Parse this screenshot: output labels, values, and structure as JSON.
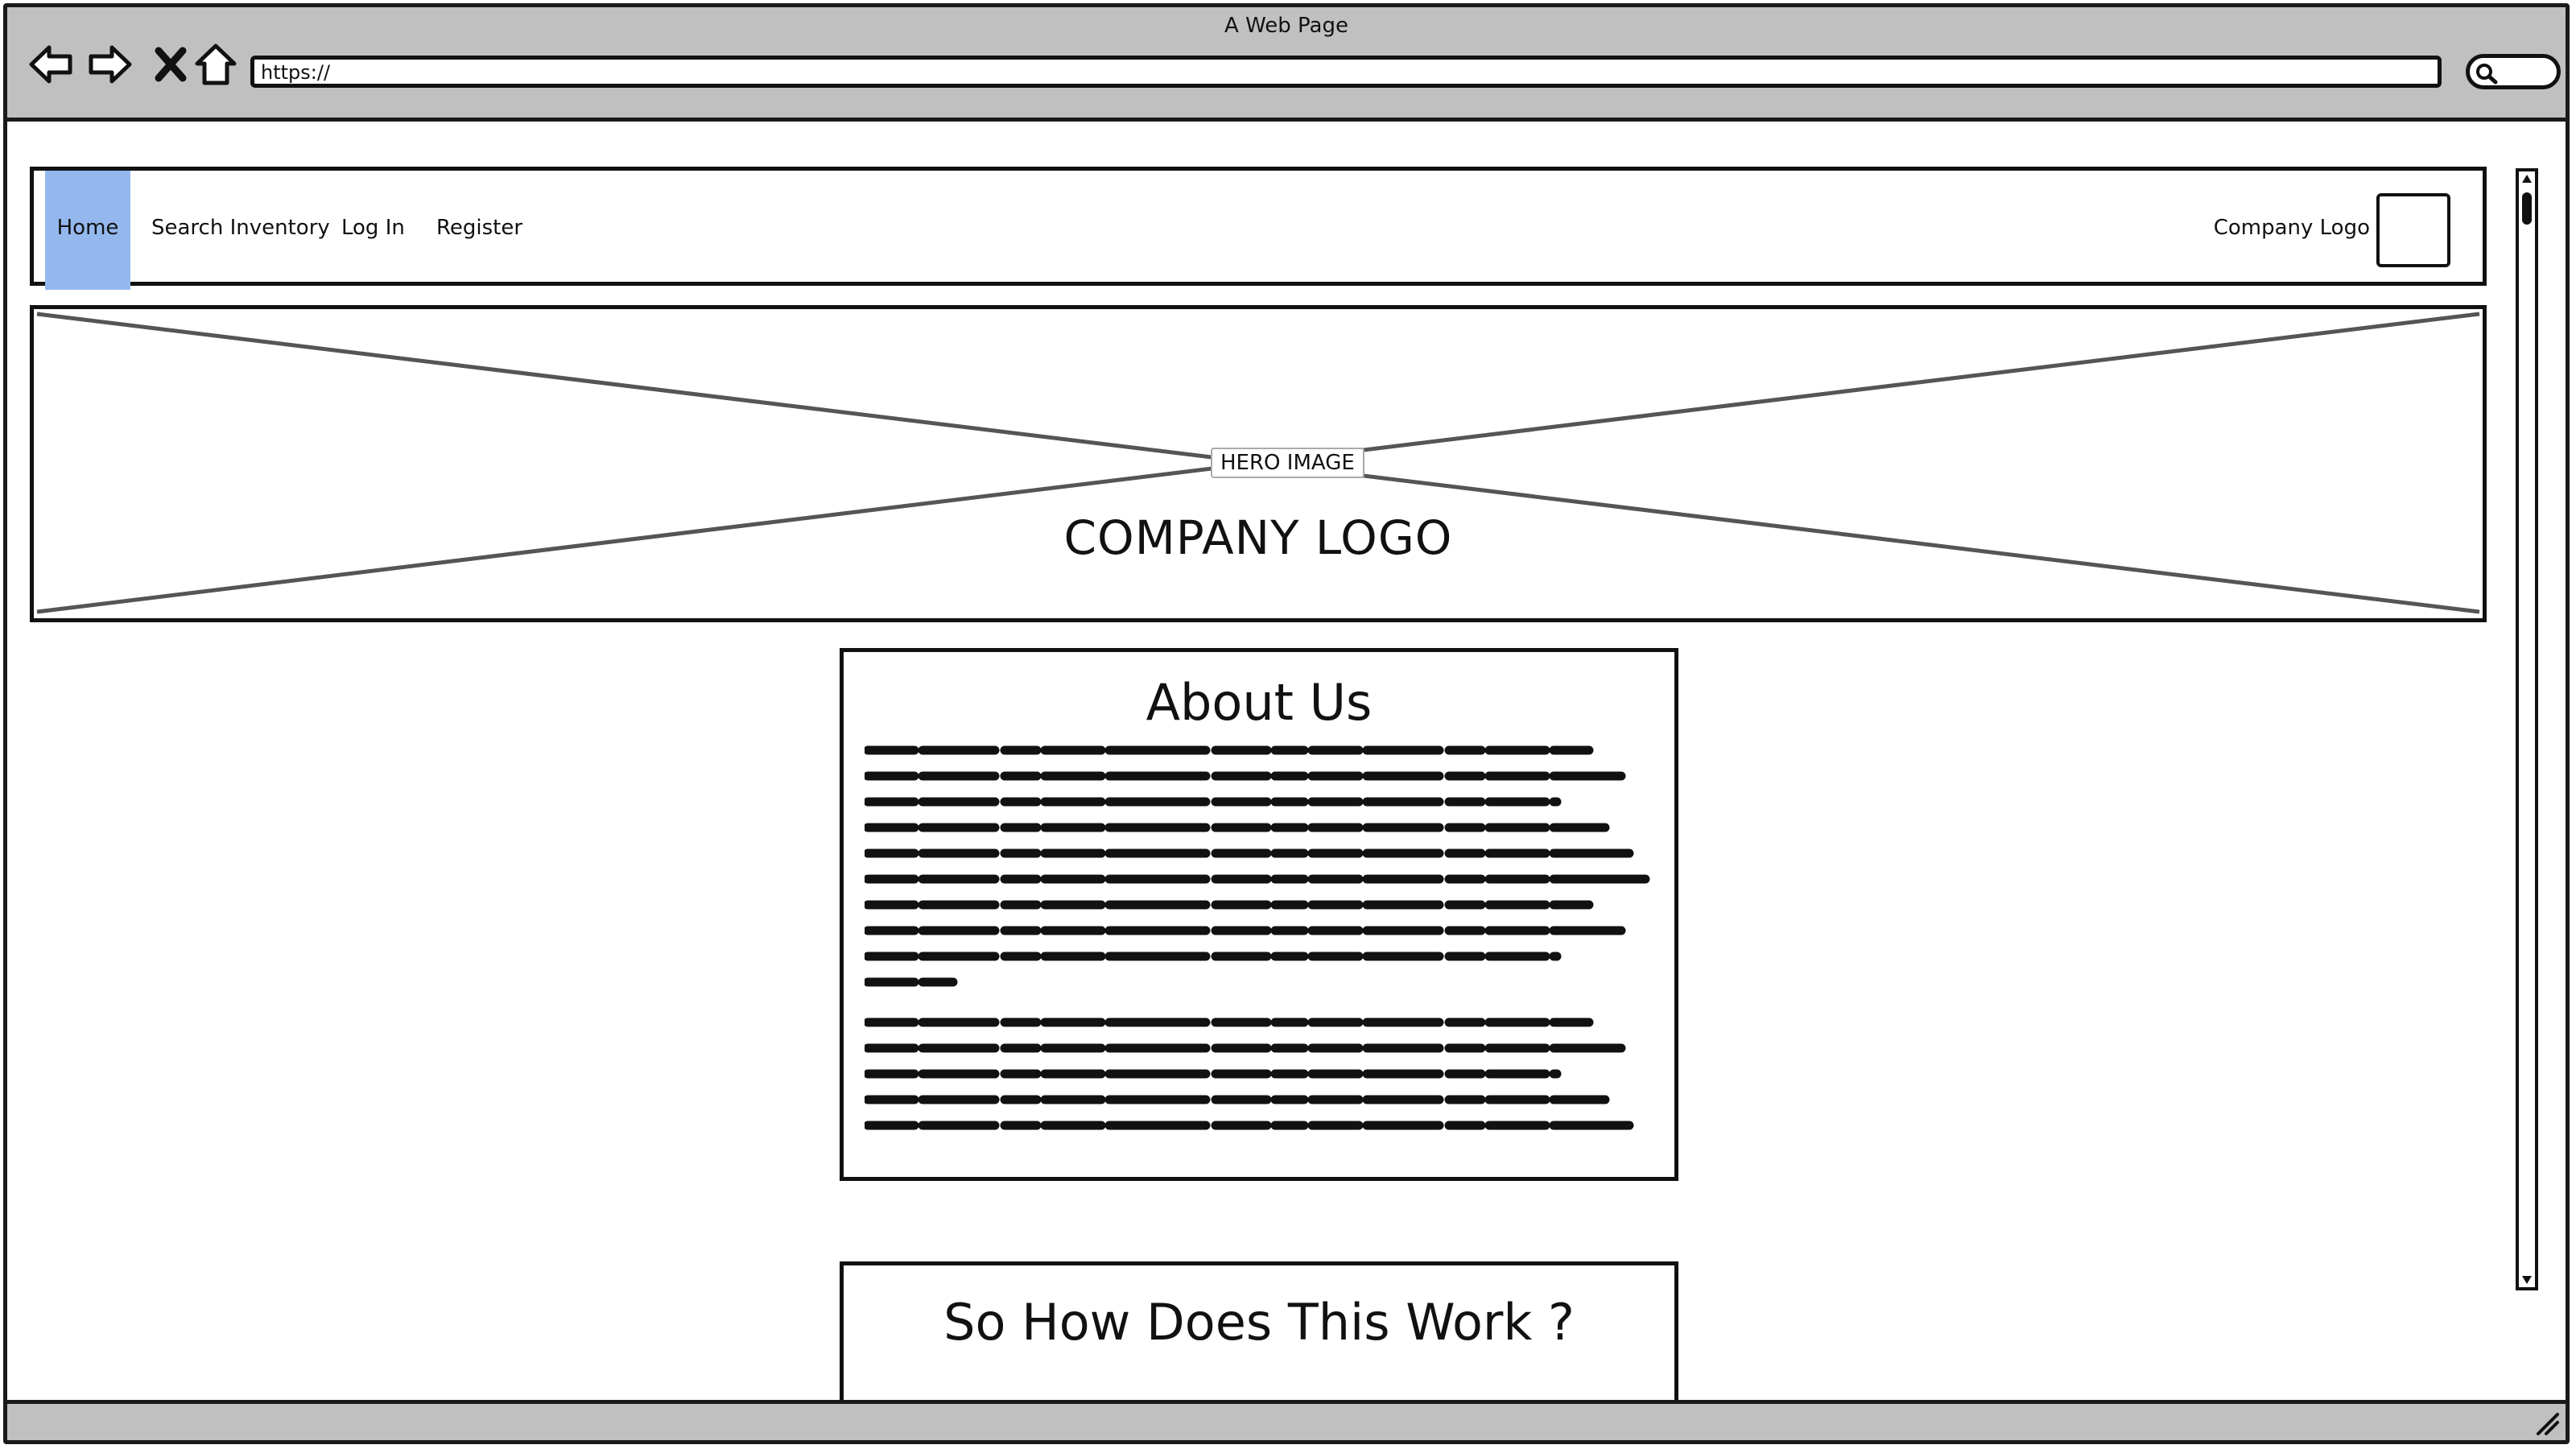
{
  "window": {
    "title": "A Web Page"
  },
  "browser": {
    "nav_icons": [
      "back-arrow-icon",
      "forward-arrow-icon",
      "stop-x-icon",
      "home-icon"
    ],
    "url": "https://",
    "search_icon": "magnifier-icon"
  },
  "site_nav": {
    "items": [
      {
        "label": "Home",
        "active": true
      },
      {
        "label": "Search Inventory",
        "active": false
      },
      {
        "label": "Log In",
        "active": false
      },
      {
        "label": "Register",
        "active": false
      }
    ],
    "logo_label": "Company Logo",
    "active_color": "#94b8ee"
  },
  "hero": {
    "label": "HERO IMAGE",
    "logo_text": "COMPANY LOGO"
  },
  "about": {
    "title": "About Us",
    "paragraph_1": "(illegible placeholder text)",
    "paragraph_2": "(illegible placeholder text)"
  },
  "how_it_works": {
    "title": "So How Does This Work ?"
  },
  "colors": {
    "chrome": "#c0c0c0",
    "highlight": "#94b8ee",
    "stroke": "#111111"
  }
}
